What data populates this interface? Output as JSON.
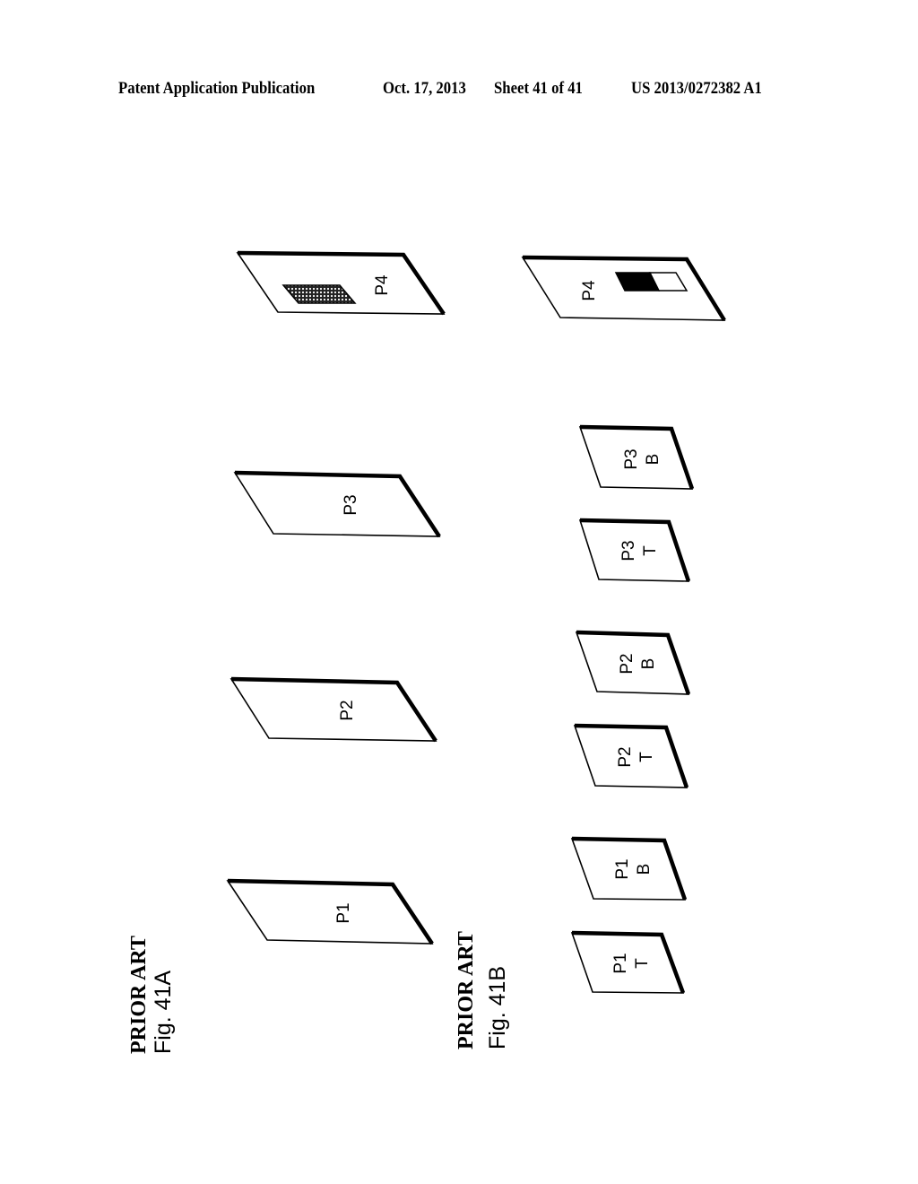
{
  "header": {
    "publication_type": "Patent Application Publication",
    "date": "Oct. 17, 2013",
    "sheet": "Sheet 41 of 41",
    "patent_number": "US 2013/0272382 A1"
  },
  "figures": [
    {
      "caption_prior": "PRIOR ART",
      "caption_fig": "Fig. 41A",
      "sheets": [
        {
          "label": "P1"
        },
        {
          "label": "P2"
        },
        {
          "label": "P3"
        },
        {
          "label": "P4",
          "marker": "dotted-grid-region"
        }
      ]
    },
    {
      "caption_prior": "PRIOR ART",
      "caption_fig": "Fig. 41B",
      "sheets": [
        {
          "label": "P1",
          "sublabel": "T"
        },
        {
          "label": "P1",
          "sublabel": "B"
        },
        {
          "label": "P2",
          "sublabel": "T"
        },
        {
          "label": "P2",
          "sublabel": "B"
        },
        {
          "label": "P3",
          "sublabel": "T"
        },
        {
          "label": "P3",
          "sublabel": "B"
        },
        {
          "label": "P4",
          "marker": "half-filled-box"
        }
      ]
    }
  ]
}
